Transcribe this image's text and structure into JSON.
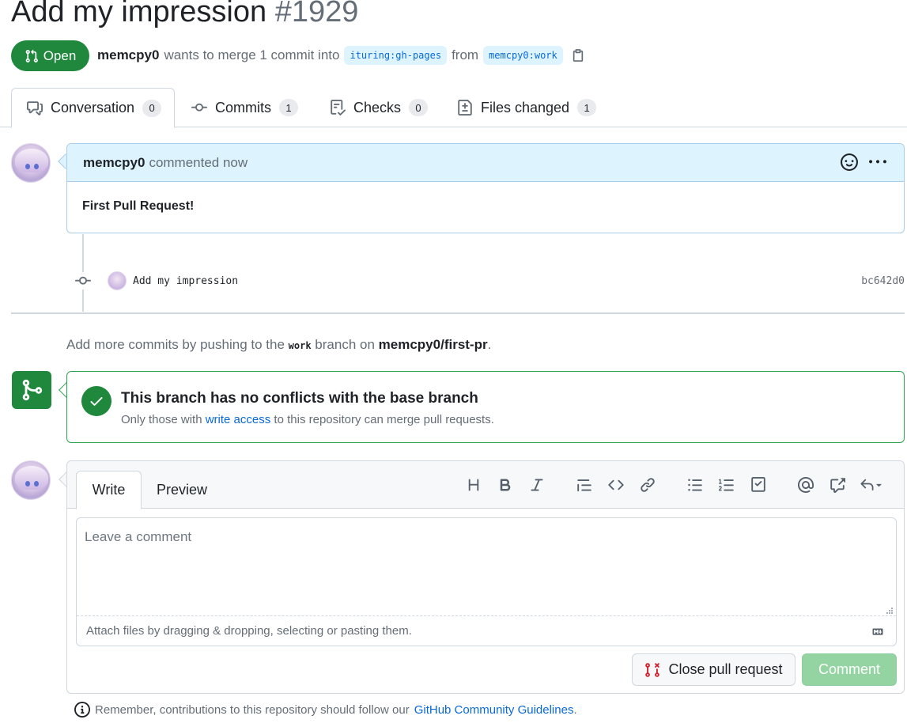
{
  "pr": {
    "title": "Add my impression",
    "number": "#1929",
    "state": "Open",
    "author": "memcpy0",
    "merge_text": "wants to merge 1 commit into",
    "base_branch": "ituring:gh-pages",
    "from_text": "from",
    "head_branch": "memcpy0:work"
  },
  "tabs": [
    {
      "label": "Conversation",
      "count": "0",
      "icon": "comment-discussion-icon"
    },
    {
      "label": "Commits",
      "count": "1",
      "icon": "git-commit-icon"
    },
    {
      "label": "Checks",
      "count": "0",
      "icon": "checklist-icon"
    },
    {
      "label": "Files changed",
      "count": "1",
      "icon": "file-diff-icon"
    }
  ],
  "comment": {
    "author": "memcpy0",
    "action": "commented now",
    "body": "First Pull Request!"
  },
  "commit": {
    "message": "Add my impression",
    "sha": "bc642d0"
  },
  "push_note": {
    "prefix": "Add more commits by pushing to the",
    "branch": "work",
    "middle": "branch on",
    "repo": "memcpy0/first-pr",
    "suffix": "."
  },
  "merge": {
    "title": "This branch has no conflicts with the base branch",
    "sub_prefix": "Only those with",
    "sub_link": "write access",
    "sub_suffix": "to this repository can merge pull requests."
  },
  "composer": {
    "write_tab": "Write",
    "preview_tab": "Preview",
    "placeholder": "Leave a comment",
    "attach_text": "Attach files by dragging & dropping, selecting or pasting them.",
    "close_label": "Close pull request",
    "comment_label": "Comment",
    "toolbar": [
      "heading-icon",
      "bold-icon",
      "italic-icon",
      "quote-icon",
      "code-icon",
      "link-icon",
      "unordered-list-icon",
      "ordered-list-icon",
      "task-list-icon",
      "mention-icon",
      "cross-reference-icon",
      "reply-icon"
    ]
  },
  "footer": {
    "prefix": "Remember, contributions to this repository should follow our",
    "link": "GitHub Community Guidelines",
    "suffix": "."
  },
  "colors": {
    "green": "#1f883d",
    "link": "#0969da",
    "comment_header": "#ddf4ff",
    "disabled_green": "#94d3a2"
  }
}
